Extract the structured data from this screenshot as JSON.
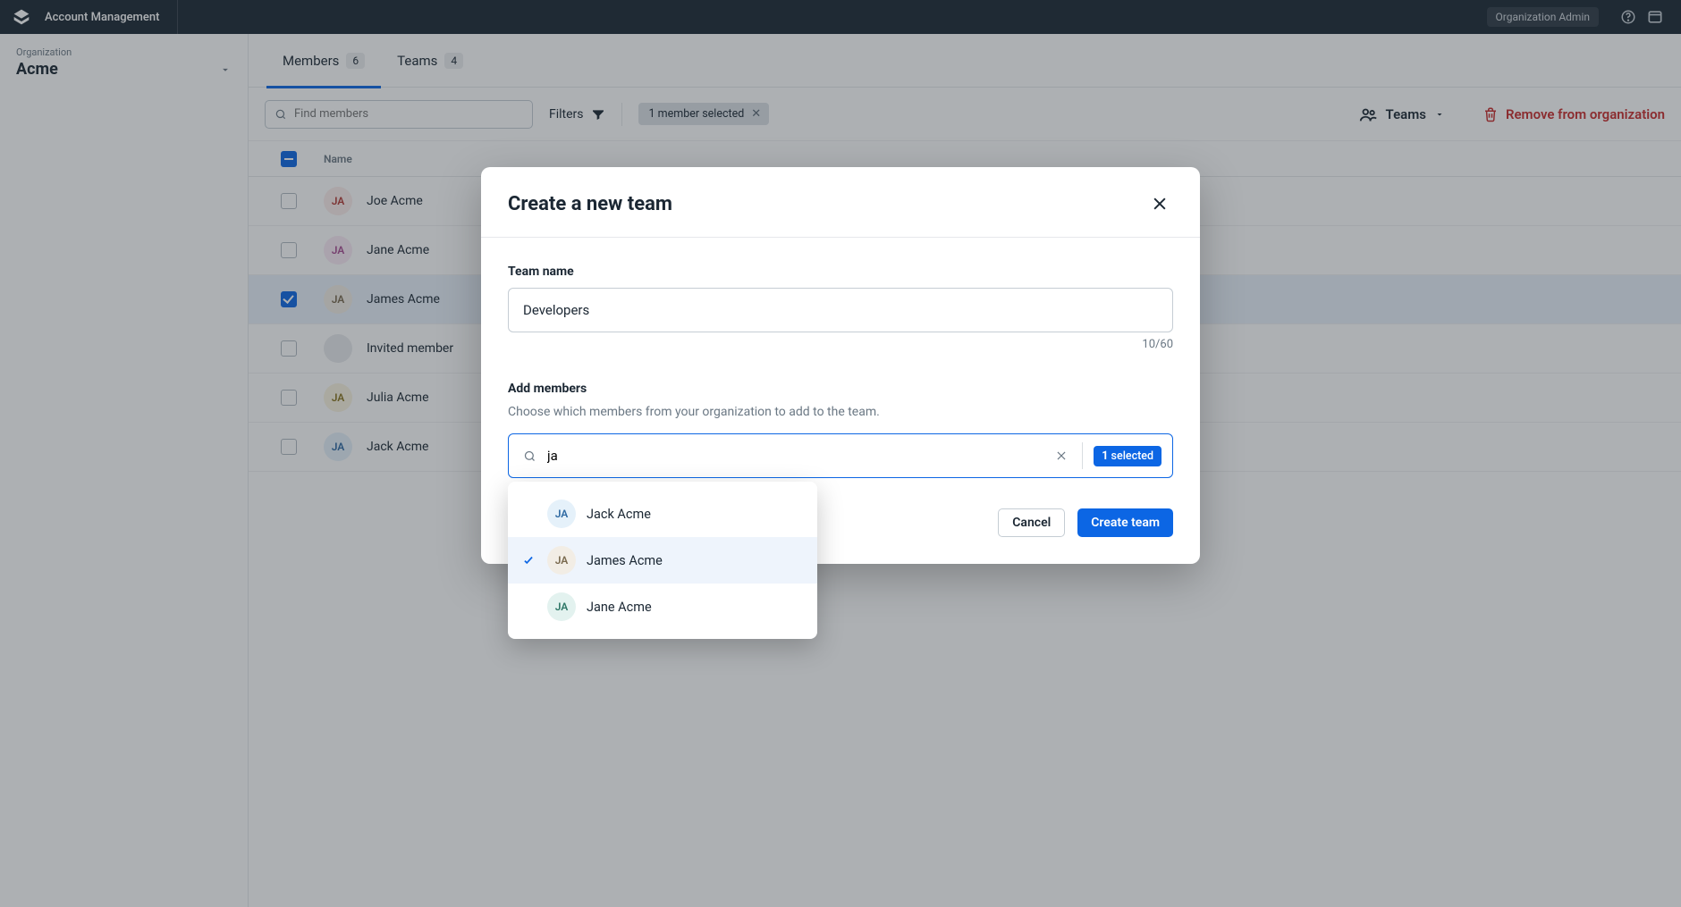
{
  "topbar": {
    "title": "Account Management",
    "org_badge": "Organization Admin"
  },
  "sidebar": {
    "org_label": "Organization",
    "org_name": "Acme"
  },
  "tabs": {
    "members": {
      "label": "Members",
      "count": "6"
    },
    "teams": {
      "label": "Teams",
      "count": "4"
    }
  },
  "toolbar": {
    "search_placeholder": "Find members",
    "filters_label": "Filters",
    "selected_chip": "1 member selected",
    "teams_label": "Teams",
    "remove_label": "Remove from organization"
  },
  "table": {
    "header_name": "Name",
    "rows": [
      {
        "initials": "JA",
        "name": "Joe Acme",
        "avatar": "av-red",
        "selected": false,
        "placeholder": false
      },
      {
        "initials": "JA",
        "name": "Jane Acme",
        "avatar": "av-pink",
        "selected": false,
        "placeholder": false
      },
      {
        "initials": "JA",
        "name": "James Acme",
        "avatar": "av-brown",
        "selected": true,
        "placeholder": false
      },
      {
        "initials": "",
        "name": "Invited member",
        "avatar": "av-grey",
        "selected": false,
        "placeholder": true
      },
      {
        "initials": "JA",
        "name": "Julia Acme",
        "avatar": "av-yellow",
        "selected": false,
        "placeholder": false
      },
      {
        "initials": "JA",
        "name": "Jack Acme",
        "avatar": "av-blue",
        "selected": false,
        "placeholder": false
      }
    ]
  },
  "modal": {
    "title": "Create a new team",
    "team_name_label": "Team name",
    "team_name_value": "Developers",
    "counter": "10/60",
    "add_members_label": "Add members",
    "add_members_hint": "Choose which members from your organization to add to the team.",
    "search_value": "ja",
    "selected_count": "1",
    "selected_suffix": " selected",
    "cancel_label": "Cancel",
    "create_label": "Create team",
    "options": [
      {
        "initials": "JA",
        "name": "Jack Acme",
        "avatar": "av-blue",
        "checked": false,
        "active": false
      },
      {
        "initials": "JA",
        "name": "James Acme",
        "avatar": "av-brown",
        "checked": true,
        "active": true
      },
      {
        "initials": "JA",
        "name": "Jane Acme",
        "avatar": "av-teal",
        "checked": false,
        "active": false
      }
    ]
  }
}
